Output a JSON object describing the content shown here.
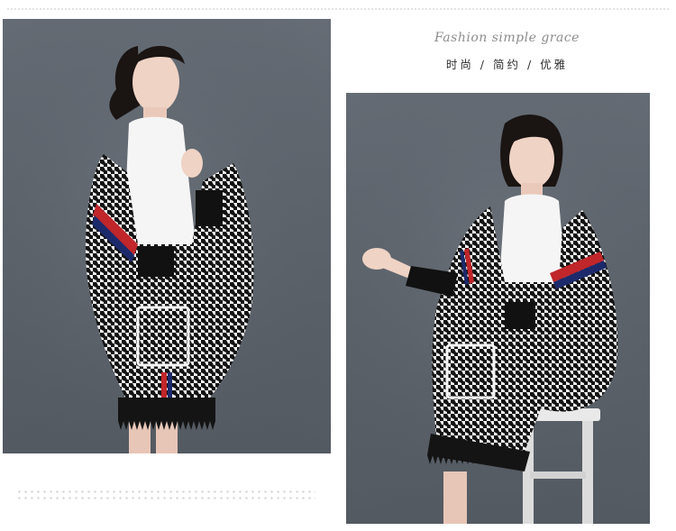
{
  "tagline": {
    "script": "Fashion  simple  grace",
    "chinese": "时尚 / 简约 / 优雅"
  },
  "photos": [
    {
      "name": "model-photo-left",
      "background_color": "#5f666e",
      "garment_colors": [
        "#111111",
        "#f4f4f4",
        "#c0262a",
        "#1c2a6b"
      ]
    },
    {
      "name": "model-photo-right",
      "background_color": "#5f666e",
      "garment_colors": [
        "#111111",
        "#f4f4f4",
        "#c0262a",
        "#1c2a6b"
      ]
    }
  ],
  "colors": {
    "page_background": "#ffffff",
    "dot_pattern": "#d6d6d6",
    "tagline_script": "#8d8d8d",
    "tagline_chinese": "#2f2f2f"
  }
}
